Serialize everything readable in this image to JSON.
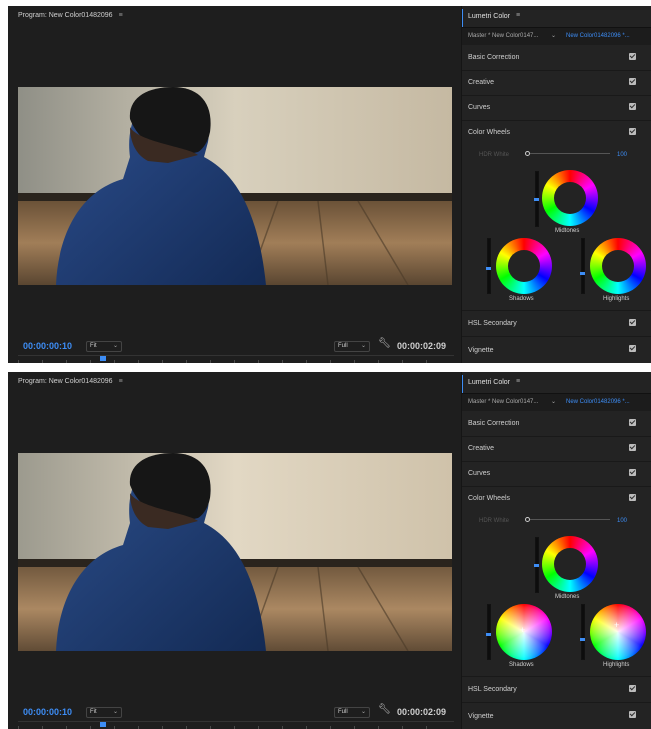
{
  "program": {
    "title": "Program: New Color01482096",
    "menu_icon": "hamburger-icon",
    "timecode": "00:00:00:10",
    "fit": "Fit",
    "quality": "Full",
    "duration": "00:00:02:09"
  },
  "lumetri": {
    "title": "Lumetri Color",
    "menu_icon": "hamburger-icon",
    "master": "Master * New Color0147...",
    "clip": "New Color01482096 *...",
    "sections": {
      "basic": "Basic Correction",
      "creative": "Creative",
      "curves": "Curves",
      "wheels": "Color Wheels",
      "hsl": "HSL Secondary",
      "vignette": "Vignette"
    },
    "hdr_white_label": "HDR White",
    "hdr_white_value": "100",
    "wheels": {
      "midtones": "Midtones",
      "shadows": "Shadows",
      "highlights": "Highlights"
    }
  },
  "colors": {
    "accent": "#3d8df5",
    "panel_bg": "#1e1e1e",
    "lumetri_bg": "#232323"
  },
  "screenshots": [
    {
      "wheel_state": "ring"
    },
    {
      "wheel_state": "filled"
    }
  ]
}
